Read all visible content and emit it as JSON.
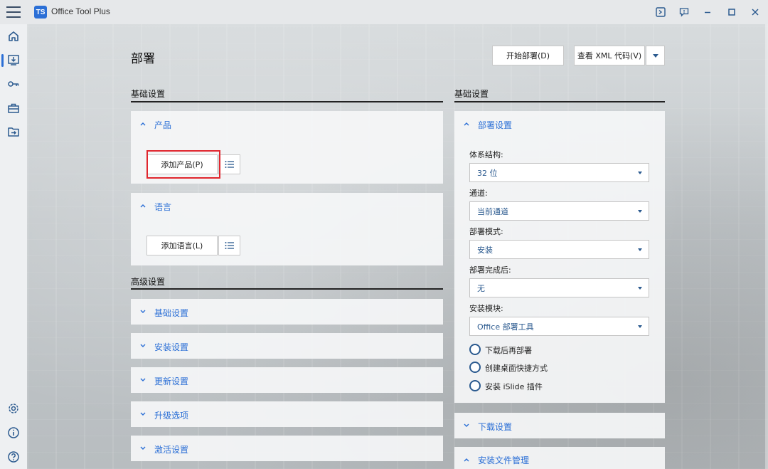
{
  "titlebar": {
    "app_title": "Office Tool Plus",
    "logo_text": "TS"
  },
  "page": {
    "title": "部署",
    "start_button": "开始部署(D)",
    "view_xml_button": "查看 XML 代码(V)"
  },
  "left_column": {
    "basic_heading": "基础设置",
    "product_card": {
      "title": "产品",
      "add_button": "添加产品(P)"
    },
    "language_card": {
      "title": "语言",
      "add_button": "添加语言(L)"
    },
    "advanced_heading": "高级设置",
    "advanced_items": [
      "基础设置",
      "安装设置",
      "更新设置",
      "升级选项",
      "激活设置"
    ]
  },
  "right_column": {
    "basic_heading": "基础设置",
    "deploy_card": {
      "title": "部署设置",
      "fields": [
        {
          "label": "体系结构:",
          "value": "32 位"
        },
        {
          "label": "通道:",
          "value": "当前通道"
        },
        {
          "label": "部署模式:",
          "value": "安装"
        },
        {
          "label": "部署完成后:",
          "value": "无"
        },
        {
          "label": "安装模块:",
          "value": "Office 部署工具"
        }
      ],
      "options": [
        "下载后再部署",
        "创建桌面快捷方式",
        "安装 iSlide 插件"
      ]
    },
    "download_card": {
      "title": "下载设置"
    },
    "install_files_card": {
      "title": "安装文件管理"
    }
  },
  "colors": {
    "accent": "#2b6fd6",
    "link_text": "#2b5a8f",
    "highlight_box": "#e0262e"
  }
}
